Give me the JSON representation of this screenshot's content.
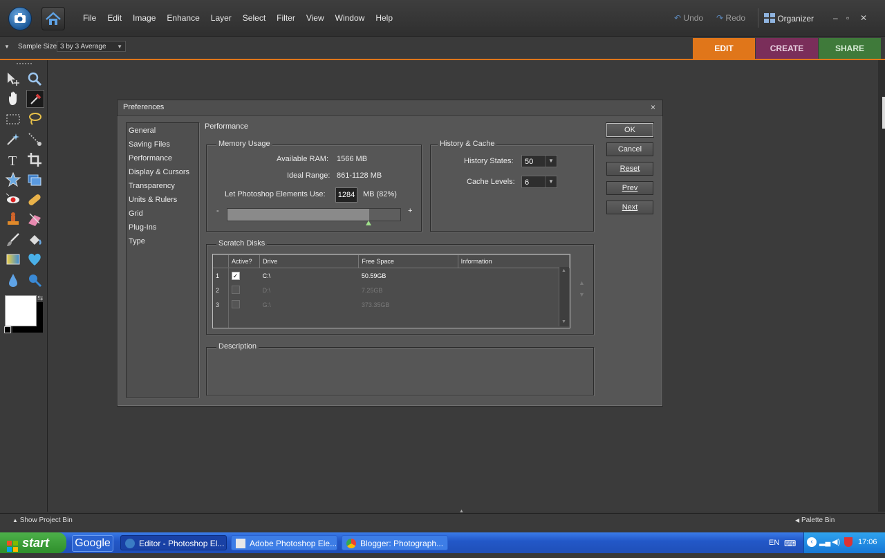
{
  "menubar": {
    "menus": [
      "File",
      "Edit",
      "Image",
      "Enhance",
      "Layer",
      "Select",
      "Filter",
      "View",
      "Window",
      "Help"
    ],
    "undo": "Undo",
    "redo": "Redo",
    "organizer": "Organizer"
  },
  "options": {
    "sample_size_label": "Sample Size:",
    "sample_size_value": "3 by 3 Average"
  },
  "mode_tabs": [
    {
      "label": "EDIT",
      "color": "#e0761a"
    },
    {
      "label": "CREATE",
      "color": "#7a2e5a"
    },
    {
      "label": "SHARE",
      "color": "#3f7a3a"
    }
  ],
  "bottom": {
    "project_bin": "Show Project Bin",
    "palette_bin": "Palette Bin"
  },
  "dialog": {
    "title": "Preferences",
    "close": "×",
    "sidebar": [
      "General",
      "Saving Files",
      "Performance",
      "Display & Cursors",
      "Transparency",
      "Units & Rulers",
      "Grid",
      "Plug-Ins",
      "Type"
    ],
    "section_title": "Performance",
    "memory": {
      "legend": "Memory Usage",
      "ram_label": "Available RAM:",
      "ram_value": "1566 MB",
      "range_label": "Ideal Range:",
      "range_value": "861-1128 MB",
      "use_label": "Let Photoshop Elements Use:",
      "use_value": "1284",
      "use_unit": "MB (82%)",
      "slider_min": "-",
      "slider_max": "+",
      "slider_fraction": 0.82
    },
    "history": {
      "legend": "History & Cache",
      "states_label": "History States:",
      "states_value": "50",
      "cache_label": "Cache Levels:",
      "cache_value": "6"
    },
    "scratch": {
      "legend": "Scratch Disks",
      "headers": [
        "Active?",
        "Drive",
        "Free Space",
        "Information"
      ],
      "rows": [
        {
          "num": "1",
          "checked": true,
          "drive": "C:\\",
          "free": "50.59GB",
          "enabled": true
        },
        {
          "num": "2",
          "checked": false,
          "drive": "D:\\",
          "free": "7.25GB",
          "enabled": false
        },
        {
          "num": "3",
          "checked": false,
          "drive": "G:\\",
          "free": "373.35GB",
          "enabled": false
        }
      ]
    },
    "description": {
      "legend": "Description"
    },
    "buttons": {
      "ok": "OK",
      "cancel": "Cancel",
      "reset": "Reset",
      "prev": "Prev",
      "next": "Next"
    }
  },
  "taskbar": {
    "start": "start",
    "google": "Google",
    "items": [
      "Editor - Photoshop El...",
      "Adobe Photoshop Ele...",
      "Blogger: Photograph..."
    ],
    "lang": "EN",
    "time": "17:06"
  }
}
